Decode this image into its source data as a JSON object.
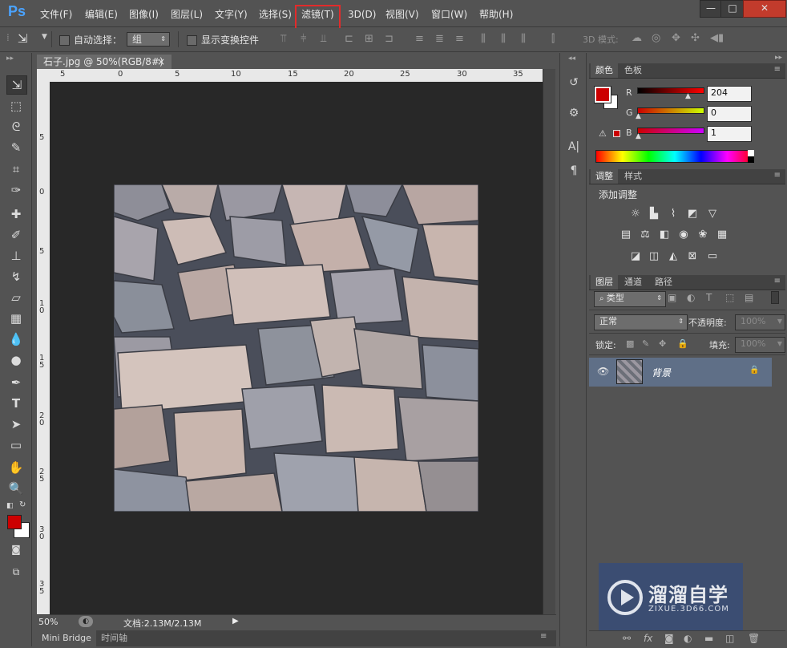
{
  "app": {
    "logo": "Ps"
  },
  "menu": [
    "文件(F)",
    "编辑(E)",
    "图像(I)",
    "图层(L)",
    "文字(Y)",
    "选择(S)",
    "滤镜(T)",
    "3D(D)",
    "视图(V)",
    "窗口(W)",
    "帮助(H)"
  ],
  "window_controls": [
    "—",
    "□",
    "✕"
  ],
  "options": {
    "auto_select_label": "自动选择：",
    "auto_select_value": "组",
    "show_transform_label": "显示变换控件",
    "mode3d_label": "3D 模式:"
  },
  "document": {
    "tab_title": "石子.jpg @ 50%(RGB/8#)",
    "tab_close": "×",
    "ruler_top_ticks": [
      "5",
      "0",
      "5",
      "10",
      "15",
      "20",
      "25",
      "30",
      "35"
    ],
    "ruler_left_ticks": [
      "5",
      "0",
      "5",
      "1 0",
      "1 5",
      "2 0",
      "2 5",
      "3 0",
      "3 5"
    ],
    "zoom": "50%",
    "doc_info": "文档:2.13M/2.13M",
    "bottom_tabs": [
      "Mini Bridge",
      "时间轴"
    ]
  },
  "color_panel": {
    "tabs": [
      "颜色",
      "色板"
    ],
    "channels": [
      {
        "label": "R",
        "value": "204"
      },
      {
        "label": "G",
        "value": "0"
      },
      {
        "label": "B",
        "value": "1"
      }
    ],
    "foreground": "#cc0001",
    "background": "#ffffff"
  },
  "adjustments_panel": {
    "tabs": [
      "调整",
      "样式"
    ],
    "title": "添加调整"
  },
  "layers_panel": {
    "tabs": [
      "图层",
      "通道",
      "路径"
    ],
    "filter_kind": "类型",
    "blend_mode": "正常",
    "opacity_label": "不透明度:",
    "opacity_value": "100%",
    "lock_label": "锁定:",
    "fill_label": "填充:",
    "fill_value": "100%",
    "layer_name": "背景"
  },
  "watermark": {
    "text_cn": "溜溜自学",
    "text_en": "ZIXUE.3D66.COM"
  }
}
